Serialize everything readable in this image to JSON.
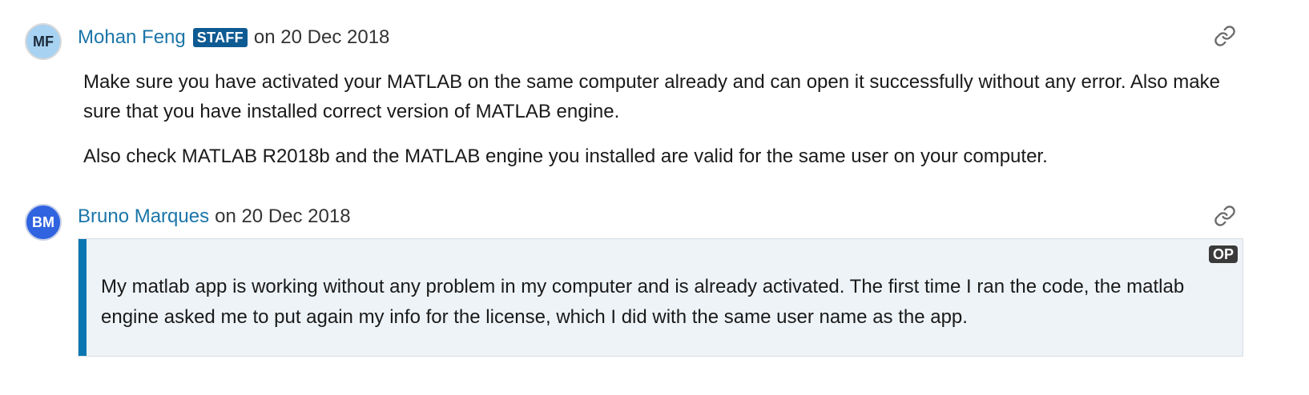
{
  "comments": [
    {
      "avatar_initials": "MF",
      "author": "Mohan Feng",
      "badge": "STAFF",
      "date": "on 20 Dec 2018",
      "link_icon": "link-icon",
      "paragraphs": [
        "Make sure you have activated your MATLAB on the same computer already and can open it successfully without any error. Also make sure that you have installed correct version of MATLAB engine.",
        "Also check MATLAB R2018b and the MATLAB engine you installed are valid for the same user on your computer."
      ],
      "avatar_color": "#a7d2f2"
    },
    {
      "avatar_initials": "BM",
      "author": "Bruno Marques",
      "date": "on 20 Dec 2018",
      "link_icon": "link-icon",
      "op_badge": "OP",
      "paragraphs": [
        "My matlab app is working without any problem in my computer and is already activated. The first time I ran the code, the matlab engine asked me to put again my info for the license, which I did with the same user name as the app."
      ],
      "avatar_color": "#2f63e0"
    }
  ],
  "colors": {
    "author_link": "#1b75a8",
    "staff_badge": "#0e5a92",
    "op_accent": "#0b76b1",
    "op_background": "#eef3f7"
  }
}
